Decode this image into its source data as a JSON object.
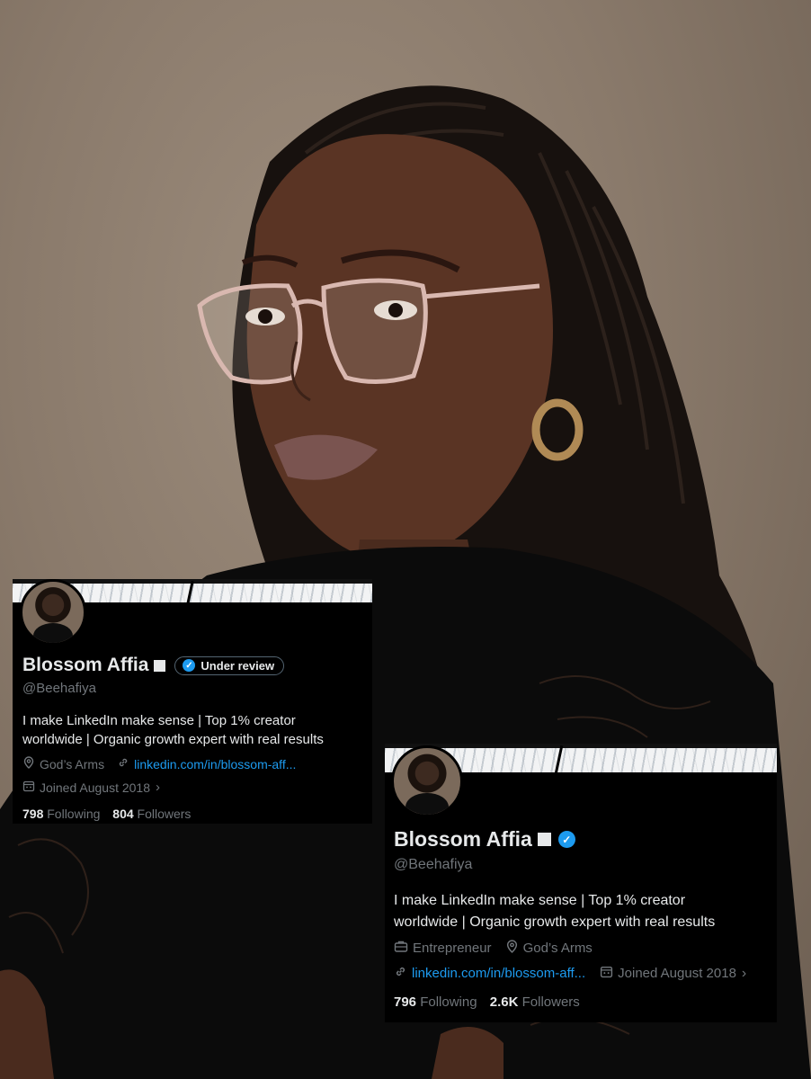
{
  "card_a": {
    "name": "Blossom Affia",
    "status_badge": "Under review",
    "handle": "@Beehafiya",
    "bio_line1": "I make LinkedIn make sense | Top 1% creator",
    "bio_line2": "worldwide | Organic growth expert with real results",
    "location": "God’s Arms",
    "website": "linkedin.com/in/blossom-aff...",
    "joined": "Joined August 2018",
    "following_count": "798",
    "following_label": "Following",
    "followers_count": "804",
    "followers_label": "Followers"
  },
  "card_b": {
    "name": "Blossom Affia",
    "handle": "@Beehafiya",
    "bio_line1": "I make LinkedIn make sense | Top 1% creator",
    "bio_line2": "worldwide | Organic growth expert with real results",
    "category": "Entrepreneur",
    "location": "God’s Arms",
    "website": "linkedin.com/in/blossom-aff...",
    "joined": "Joined August 2018",
    "following_count": "796",
    "following_label": "Following",
    "followers_count": "2.6K",
    "followers_label": "Followers"
  },
  "colors": {
    "background": "#000000",
    "text_primary": "#e7e9ea",
    "text_secondary": "#71767b",
    "link": "#1d9bf0",
    "verified": "#1d9bf0"
  },
  "icons": [
    "location-icon",
    "link-icon",
    "calendar-icon",
    "briefcase-icon",
    "verified-badge-icon",
    "chevron-right-icon"
  ]
}
